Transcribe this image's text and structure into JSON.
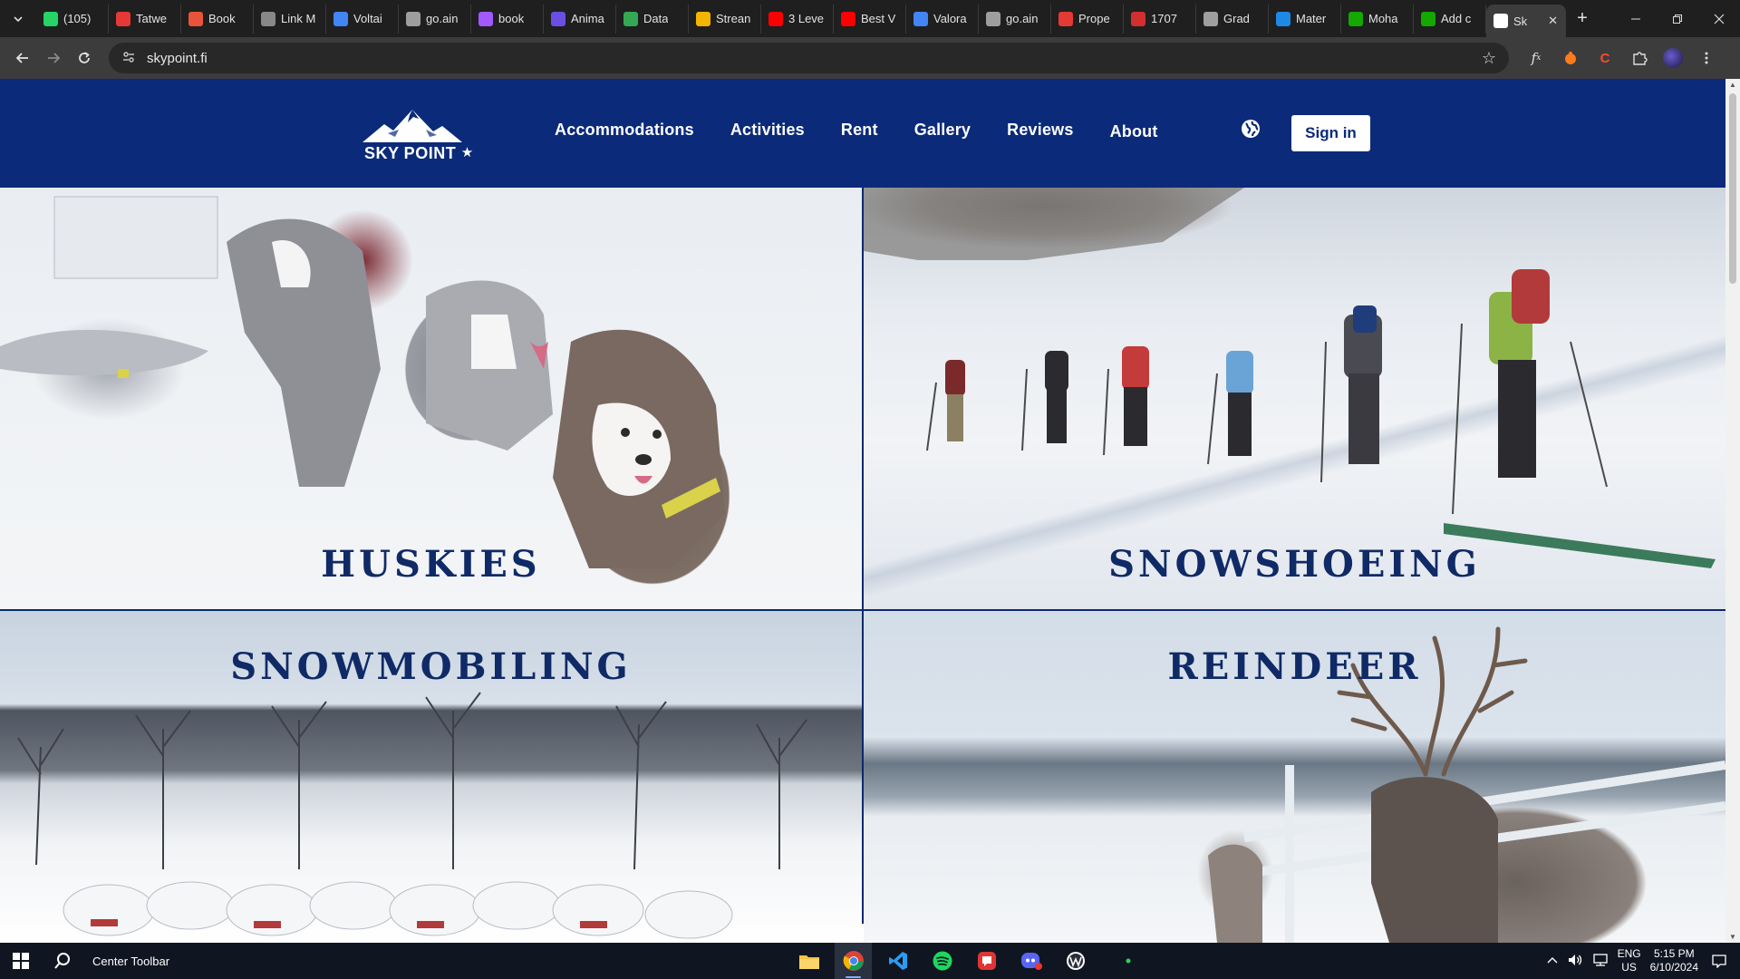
{
  "browser": {
    "tabs": [
      {
        "label": "(105)",
        "favicon": "whatsapp-icon",
        "color": "#25d366"
      },
      {
        "label": "Tatwe",
        "favicon": "dot-icon",
        "color": "#e53935"
      },
      {
        "label": "Book",
        "favicon": "book-icon",
        "color": "#e8543a"
      },
      {
        "label": "Link M",
        "favicon": "link-icon",
        "color": "#888888"
      },
      {
        "label": "Voltai",
        "favicon": "docs-icon",
        "color": "#4285f4"
      },
      {
        "label": "go.ain",
        "favicon": "globe-icon",
        "color": "#9e9e9e"
      },
      {
        "label": "book",
        "favicon": "figma-icon",
        "color": "#a259ff"
      },
      {
        "label": "Anima",
        "favicon": "anima-icon",
        "color": "#6c4ee3"
      },
      {
        "label": "Data",
        "favicon": "drop-icon",
        "color": "#34a853"
      },
      {
        "label": "Strean",
        "favicon": "slides-icon",
        "color": "#f4b400"
      },
      {
        "label": "3 Leve",
        "favicon": "youtube-icon",
        "color": "#ff0000"
      },
      {
        "label": "Best V",
        "favicon": "youtube-icon",
        "color": "#ff0000"
      },
      {
        "label": "Valora",
        "favicon": "docs-icon",
        "color": "#4285f4"
      },
      {
        "label": "go.ain",
        "favicon": "globe-icon",
        "color": "#9e9e9e"
      },
      {
        "label": "Prope",
        "favicon": "pin-icon",
        "color": "#e53935"
      },
      {
        "label": "1707",
        "favicon": "r-icon",
        "color": "#d32f2f"
      },
      {
        "label": "Grad",
        "favicon": "grad-icon",
        "color": "#9e9e9e"
      },
      {
        "label": "Mater",
        "favicon": "material-icon",
        "color": "#1e88e5"
      },
      {
        "label": "Moha",
        "favicon": "upwork-icon",
        "color": "#14a800"
      },
      {
        "label": "Add c",
        "favicon": "upwork-icon",
        "color": "#14a800"
      },
      {
        "label": "Sk",
        "favicon": "skypoint-icon",
        "color": "#ffffff"
      }
    ],
    "new_tab": "+",
    "url": "skypoint.fi"
  },
  "site": {
    "logo_text": "SKY POINT",
    "nav": [
      "Accommodations",
      "Activities",
      "Rent",
      "Gallery",
      "Reviews",
      "About"
    ],
    "signin": "Sign in",
    "brand_color": "#0b2a7a",
    "activities": [
      {
        "title": "HUSKIES"
      },
      {
        "title": "SNOWSHOEING"
      },
      {
        "title": "SNOWMOBILING"
      },
      {
        "title": "REINDEER"
      }
    ]
  },
  "taskbar": {
    "toolbar_label": "Center Toolbar",
    "lang_top": "ENG",
    "lang_bottom": "US",
    "time": "5:15 PM",
    "date": "6/10/2024"
  }
}
